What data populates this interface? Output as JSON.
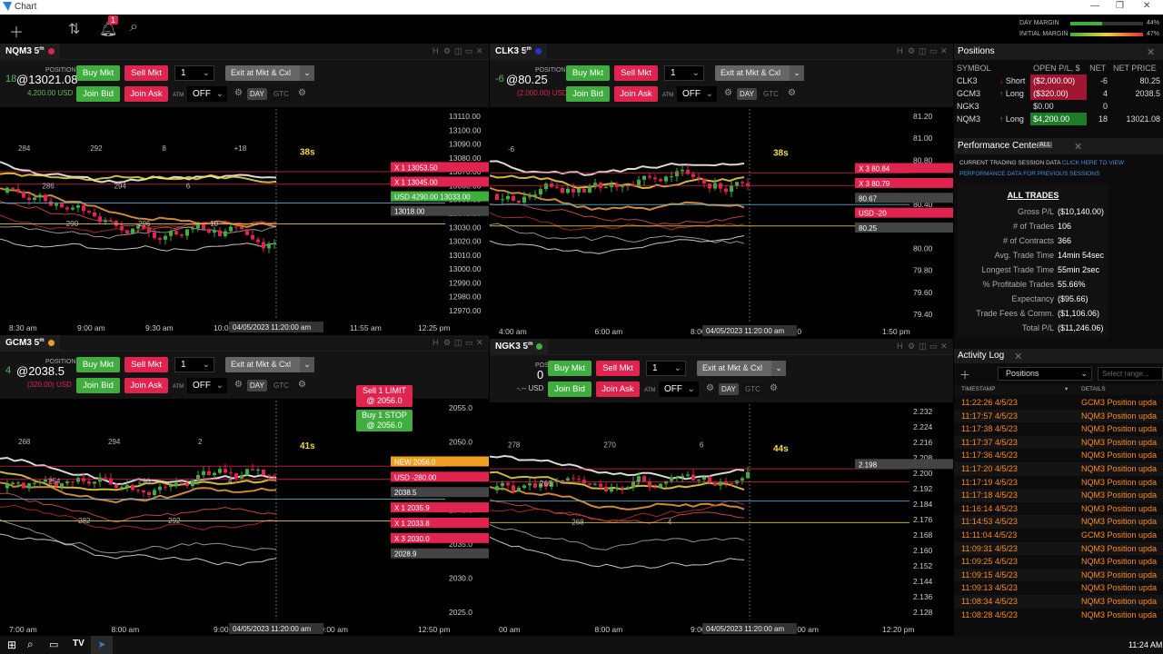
{
  "window": {
    "title": "Chart"
  },
  "appbar": {
    "notification_count": "1",
    "day_margin_label": "DAY MARGIN",
    "day_margin_value": "44%",
    "initial_margin_label": "INITIAL MARGIN",
    "initial_margin_value": "47%"
  },
  "order": {
    "buy_mkt": "Buy Mkt",
    "sell_mkt": "Sell Mkt",
    "join_bid": "Join Bid",
    "join_ask": "Join Ask",
    "exit": "Exit at Mkt & Cxl",
    "atm": "ATM",
    "off": "OFF",
    "day": "DAY",
    "gtc": "GTC",
    "position_label": "POSITION",
    "qty": "1"
  },
  "panes": {
    "nq": {
      "tab": "NQM3 5",
      "tab_sup": "m",
      "pos": "18",
      "price": "@13021.08",
      "usd": "4,200.00 USD",
      "timer": "38s",
      "yticks": [
        "13110.00",
        "13100.00",
        "13090.00",
        "13080.00",
        "13070.00",
        "13060.00",
        "13050.00",
        "13040.00",
        "13030.00",
        "13020.00",
        "13010.00",
        "13000.00",
        "12990.00",
        "12980.00",
        "12970.00"
      ],
      "xticks": [
        "8:30 am",
        "9:00 am",
        "9:30 am",
        "10:00 am",
        "10:30 am",
        "11:55 am",
        "12:25 pm"
      ],
      "cursor_time": "04/05/2023 11:20:00 am",
      "tags": [
        "X 1 13053.50",
        "X 1 13045.00",
        "USD 4290.00 13033.00",
        "13018.00"
      ],
      "labels": [
        "284",
        "286",
        "290",
        "292",
        "294",
        "296",
        "8",
        "6",
        "10",
        "+18"
      ]
    },
    "cl": {
      "tab": "CLK3 5",
      "tab_sup": "m",
      "pos": "-6",
      "price": "@80.25",
      "usd": "(2,000.00) USD",
      "timer": "38s",
      "yticks": [
        "81.20",
        "81.00",
        "80.80",
        "80.60",
        "80.40",
        "80.20",
        "80.00",
        "79.80",
        "79.60",
        "79.40"
      ],
      "xticks": [
        "4:00 am",
        "6:00 am",
        "8:00 am",
        "10:0",
        "1:50 pm"
      ],
      "cursor_time": "04/05/2023 11:20:00 am",
      "tags": [
        "X 3 80.84",
        "X 3 80.79",
        "80.67",
        "USD -20",
        "80.25"
      ],
      "labels": [
        "-6"
      ]
    },
    "gc": {
      "tab": "GCM3 5",
      "tab_sup": "m",
      "pos": "4",
      "price": "@2038.5",
      "usd": "(320.00) USD",
      "timer": "41s",
      "yticks": [
        "2055.0",
        "2050.0",
        "2045.0",
        "2040.0",
        "2035.0",
        "2030.0",
        "2025.0"
      ],
      "xticks": [
        "7:00 am",
        "8:00 am",
        "9:00 am",
        "10:00 am",
        "12:50 pm"
      ],
      "cursor_time": "04/05/2023 11:20:00 am",
      "tags": [
        "NEW 2056.0",
        "USD -280.00",
        "2038.5",
        "X 1 2035.9",
        "X 1 2033.8",
        "X 3 2030.0",
        "2028.9"
      ],
      "sell_limit": "Sell 1 LIMIT",
      "sell_limit_px": "@ 2056.0",
      "buy_stop": "Buy 1 STOP",
      "buy_stop_px": "@ 2056.0",
      "labels": [
        "268",
        "254",
        "282",
        "294",
        "296",
        "292",
        "2",
        "4"
      ]
    },
    "ng": {
      "tab": "NGK3 5",
      "tab_sup": "m",
      "pos": "0",
      "price": "",
      "usd": "-.-- USD",
      "timer": "44s",
      "yticks": [
        "2.232",
        "2.224",
        "2.216",
        "2.208",
        "2.200",
        "2.192",
        "2.184",
        "2.176",
        "2.168",
        "2.160",
        "2.152",
        "2.144",
        "2.136",
        "2.128"
      ],
      "xticks": [
        "00 am",
        "8:00 am",
        "9:00 am",
        "10:00 am",
        "12:20 pm"
      ],
      "cursor_time": "04/05/2023 11:20:00 am",
      "tags": [
        "2.198"
      ],
      "labels": [
        "278",
        "266",
        "268",
        "270",
        "2",
        "4",
        "6"
      ]
    }
  },
  "positions": {
    "title": "Positions",
    "headers": [
      "SYMBOL",
      "OPEN P/L, $",
      "NET",
      "NET PRICE"
    ],
    "rows": [
      {
        "sym": "CLK3",
        "dir": "Short",
        "pl": "($2,000.00)",
        "net": "-6",
        "price": "80.25"
      },
      {
        "sym": "GCM3",
        "dir": "Long",
        "pl": "($320.00)",
        "net": "4",
        "price": "2038.5"
      },
      {
        "sym": "NGK3",
        "dir": "",
        "pl": "$0.00",
        "net": "0",
        "price": ""
      },
      {
        "sym": "NQM3",
        "dir": "Long",
        "pl": "$4,200.00",
        "net": "18",
        "price": "13021.08"
      }
    ]
  },
  "perf": {
    "title": "Performance Center",
    "tag": "ALL",
    "note1": "CURRENT TRADING SESSION DATA",
    "note1b": "CLICK HERE TO VIEW",
    "note2": "PERFORMANCE DATA FOR PREVIOUS SESSIONS",
    "heading": "ALL TRADES",
    "rows": [
      {
        "k": "Gross P/L",
        "v": "($10,140.00)"
      },
      {
        "k": "# of Trades",
        "v": "106"
      },
      {
        "k": "# of Contracts",
        "v": "366"
      },
      {
        "k": "Avg. Trade Time",
        "v": "14min 54sec"
      },
      {
        "k": "Longest Trade Time",
        "v": "55min 2sec"
      },
      {
        "k": "% Profitable Trades",
        "v": "55.66%"
      },
      {
        "k": "Expectancy",
        "v": "($95.66)"
      },
      {
        "k": "Trade Fees & Comm.",
        "v": "($1,106.06)"
      },
      {
        "k": "Total P/L",
        "v": "($11,246.06)"
      }
    ]
  },
  "activity": {
    "title": "Activity Log",
    "filter": "Positions",
    "range_placeholder": "Select range...",
    "col1": "TIMESTAMP",
    "col2": "DETAILS",
    "rows": [
      {
        "t": "11:22:26 4/5/23",
        "d": "GCM3 Position upda"
      },
      {
        "t": "11:17:57 4/5/23",
        "d": "NQM3 Position upda"
      },
      {
        "t": "11:17:38 4/5/23",
        "d": "NQM3 Position upda"
      },
      {
        "t": "11:17:37 4/5/23",
        "d": "NQM3 Position upda"
      },
      {
        "t": "11:17:36 4/5/23",
        "d": "NQM3 Position upda"
      },
      {
        "t": "11:17:20 4/5/23",
        "d": "NQM3 Position upda"
      },
      {
        "t": "11:17:19 4/5/23",
        "d": "NQM3 Position upda"
      },
      {
        "t": "11:17:18 4/5/23",
        "d": "NQM3 Position upda"
      },
      {
        "t": "11:16:14 4/5/23",
        "d": "NQM3 Position upda"
      },
      {
        "t": "11:14:53 4/5/23",
        "d": "NQM3 Position upda"
      },
      {
        "t": "11:11:04 4/5/23",
        "d": "GCM3 Position upda"
      },
      {
        "t": "11:09:31 4/5/23",
        "d": "NQM3 Position upda"
      },
      {
        "t": "11:09:25 4/5/23",
        "d": "NQM3 Position upda"
      },
      {
        "t": "11:09:15 4/5/23",
        "d": "NQM3 Position upda"
      },
      {
        "t": "11:09:13 4/5/23",
        "d": "NQM3 Position upda"
      },
      {
        "t": "11:08:34 4/5/23",
        "d": "NQM3 Position upda"
      },
      {
        "t": "11:08:28 4/5/23",
        "d": "NQM3 Position upda"
      }
    ]
  },
  "taskbar": {
    "clock": "11:24 AM"
  }
}
